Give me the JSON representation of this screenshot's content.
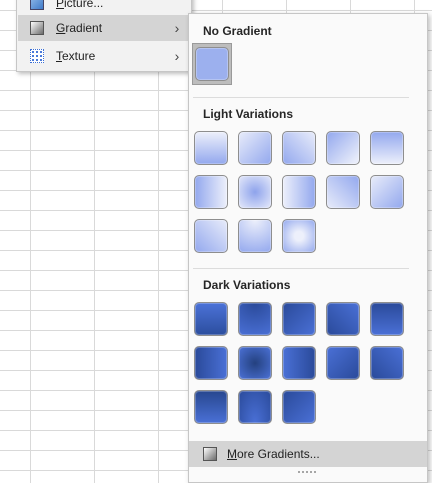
{
  "submenu": {
    "items": [
      {
        "label_html": "<span class='ul'>P</span>icture...",
        "name": "picture"
      },
      {
        "label_html": "<span class='ul'>G</span>radient",
        "name": "gradient"
      },
      {
        "label_html": "<span class='ul'>T</span>exture",
        "name": "texture"
      }
    ],
    "arrow": "›"
  },
  "panel": {
    "no_gradient_title": "No Gradient",
    "light_title": "Light Variations",
    "dark_title": "Dark Variations",
    "more_label_prefix": "M",
    "more_label_rest": "ore Gradients..."
  },
  "colors": {
    "base_light": "#a8b8f0",
    "base_dark": "#3e64c6",
    "no_gradient_fill": "#9cb0ee"
  },
  "icons": {
    "picture": "picture-icon",
    "gradient": "gradient-icon",
    "texture": "texture-icon",
    "more": "gradient-icon"
  },
  "gradients": {
    "light": [
      "linear-gradient(to bottom, #edf0fb, #93a8ee)",
      "linear-gradient(to bottom right, #e8ecfa, #93a8ee)",
      "linear-gradient(to bottom left, #e8ecfa, #93a8ee)",
      "linear-gradient(to top left, #e8ecfa 10%, #93a8ee)",
      "linear-gradient(to top, #edf0fb, #93a8ee)",
      "linear-gradient(to right, #93a8ee, #edf0fb)",
      "radial-gradient(circle at 50% 50%, #8ea3ec, #e6eafa)",
      "linear-gradient(to left, #93a8ee, #edf0fb)",
      "linear-gradient(to top right, #e8ecfa, #93a8ee)",
      "linear-gradient(to top left, #93a8ee, #e8ecfa)",
      "linear-gradient(to top right, #93a8ee, #e8ecfa)",
      "radial-gradient(circle at 50% 0%, #edf0fb, #93a8ee)",
      "radial-gradient(ellipse at 50% 50%, #edf0fb 20%, #93a8ee)"
    ],
    "dark": [
      "linear-gradient(to bottom, #4b72d8, #2c4e9e)",
      "radial-gradient(circle at 50% 0%, #2a4a9a, #4a70d6)",
      "linear-gradient(to top left, #4a70d6, #2a4a9a)",
      "linear-gradient(to bottom left, #4a70d6, #2a4a9a)",
      "linear-gradient(to top, #4a70d6, #2a4a9a)",
      "linear-gradient(to right, #2a4a9a, #4a70d6)",
      "radial-gradient(circle at 50% 50%, #24417f, #4c72d8)",
      "linear-gradient(to left, #2a4a9a, #4a70d6)",
      "linear-gradient(to bottom right, #4a70d6, #2a4a9a)",
      "linear-gradient(to top right, #2a4a9a, #4a70d6)",
      "linear-gradient(to top, #4a70d6, #27478f)",
      "radial-gradient(ellipse at 50% 100%, #4a70d6, #2a4a9a)",
      "linear-gradient(to bottom right, #2a4a9a, #4a70d6)"
    ]
  }
}
